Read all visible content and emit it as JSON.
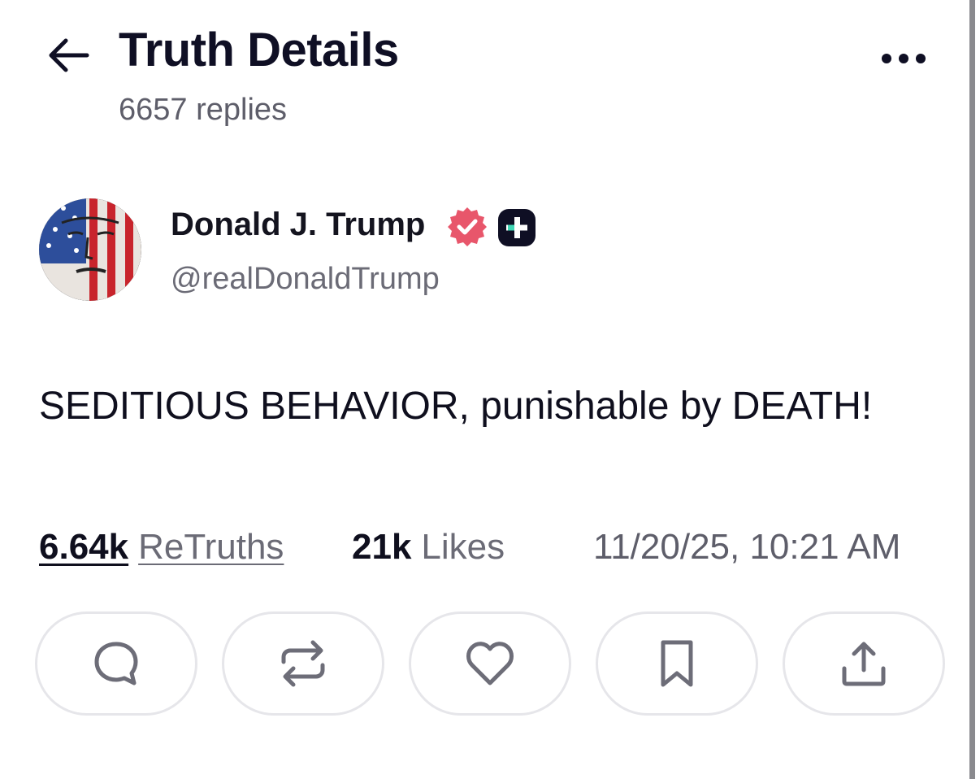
{
  "header": {
    "title": "Truth Details",
    "replies_label": "6657 replies",
    "back_icon": "arrow-left-icon",
    "more_icon": "more-horizontal-icon"
  },
  "author": {
    "name": "Donald J. Trump",
    "handle": "@realDonaldTrump",
    "verified_icon": "verified-badge-icon",
    "verified_color": "#e8566b",
    "plus_badge_icon": "plus-badge-icon",
    "plus_badge_color": "#0f0f24",
    "plus_accent_color": "#3fd6b4"
  },
  "post": {
    "text": "SEDITIOUS BEHAVIOR, punishable by DEATH!"
  },
  "stats": {
    "retruths_count": "6.64k",
    "retruths_label": "ReTruths",
    "likes_count": "21k",
    "likes_label": "Likes",
    "timestamp": "11/20/25, 10:21 AM"
  },
  "actions": [
    {
      "name": "reply",
      "icon": "comment-icon"
    },
    {
      "name": "retruth",
      "icon": "repost-icon"
    },
    {
      "name": "like",
      "icon": "heart-icon"
    },
    {
      "name": "bookmark",
      "icon": "bookmark-icon"
    },
    {
      "name": "share",
      "icon": "share-upload-icon"
    }
  ],
  "colors": {
    "text_primary": "#0f0f1e",
    "text_secondary": "#6b6b76",
    "pill_border": "#e6e6ea",
    "icon_gray": "#6d6d78"
  }
}
